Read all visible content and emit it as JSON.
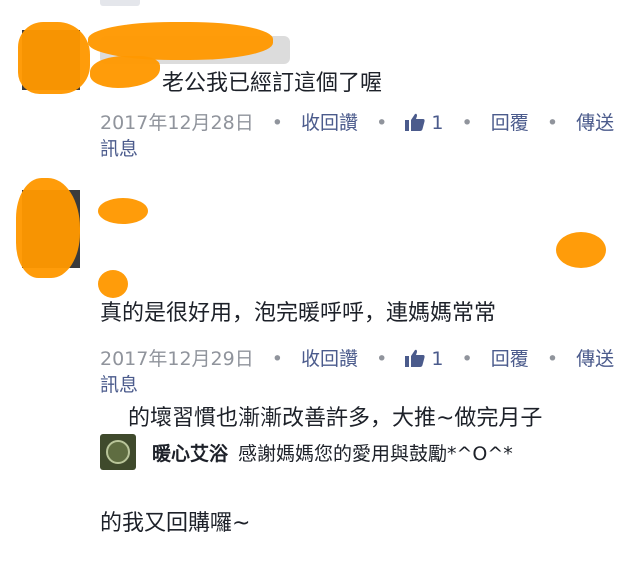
{
  "comment1": {
    "text": "老公我已經訂這個了喔",
    "date": "2017年12月28日",
    "unlike_label": "收回讚",
    "like_count": "1",
    "reply_label": "回覆",
    "send_message_label_1": "傳送",
    "send_message_label_2": "訊息"
  },
  "comment2": {
    "line1": "真的是很好用，泡完暖呼呼，連媽媽常常",
    "line2": "的壞習慣也漸漸改善許多，大推~做完月子",
    "line3": "的我又回購囉~",
    "date": "2017年12月29日",
    "unlike_label": "收回讚",
    "like_count": "1",
    "reply_label": "回覆",
    "send_message_label_1": "傳送",
    "send_message_label_2": "訊息"
  },
  "reply": {
    "name": "暖心艾浴",
    "text": "感謝媽媽您的愛用與鼓勵*^O^*"
  },
  "icons": {
    "like": "thumbs-up-icon",
    "avatar": "user-avatar",
    "reply_avatar": "shop-logo-avatar"
  },
  "colors": {
    "text": "#1d2129",
    "meta": "#90949c",
    "link": "#4b5b8c",
    "redaction": "#ff9800"
  }
}
